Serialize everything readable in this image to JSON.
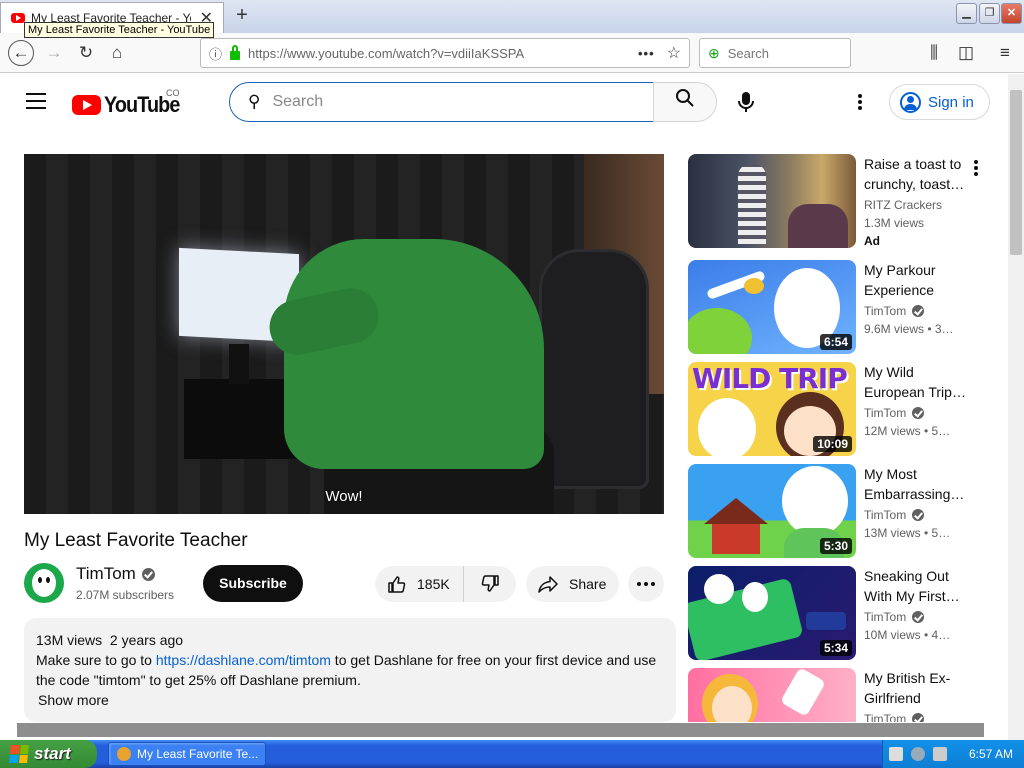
{
  "browser": {
    "tab_title": "My Least Favorite Teacher - YouTube",
    "tooltip": "My Least Favorite Teacher - YouTube",
    "url": "https://www.youtube.com/watch?v=vdiiIaKSSPA",
    "search_placeholder": "Search"
  },
  "header": {
    "logo_text": "YouTube",
    "region": "CO",
    "search_placeholder": "Search",
    "signin_label": "Sign in"
  },
  "video": {
    "caption": "Wow!",
    "title": "My Least Favorite Teacher",
    "channel": "TimTom",
    "subscribers": "2.07M subscribers",
    "subscribe_label": "Subscribe",
    "likes": "185K",
    "share_label": "Share"
  },
  "description": {
    "views": "13M views",
    "age": "2 years ago",
    "text_before": "Make sure to go to ",
    "link": "https://dashlane.com/timtom",
    "text_after": " to get Dashlane for free on your first device and use the code \"timtom\" to get 25% off Dashlane premium.",
    "show_more": "Show more"
  },
  "recommendations": [
    {
      "title": "Raise a toast to crunchy, toast…",
      "channel": "RITZ Crackers",
      "meta": "1.3M views",
      "ad": "Ad",
      "duration": "",
      "verified": false
    },
    {
      "title": "My Parkour Experience",
      "channel": "TimTom",
      "meta": "9.6M views  • 3…",
      "duration": "6:54",
      "verified": true
    },
    {
      "title": "My Wild European Trip…",
      "channel": "TimTom",
      "meta": "12M views  • 5…",
      "duration": "10:09",
      "verified": true,
      "thumb_text": "WILD TRIP"
    },
    {
      "title": "My Most Embarrassing…",
      "channel": "TimTom",
      "meta": "13M views  • 5…",
      "duration": "5:30",
      "verified": true
    },
    {
      "title": "Sneaking Out With My First…",
      "channel": "TimTom",
      "meta": "10M views  • 4…",
      "duration": "5:34",
      "verified": true
    },
    {
      "title": "My British Ex-Girlfriend",
      "channel": "TimTom",
      "meta": "",
      "duration": "",
      "verified": true
    }
  ],
  "taskbar": {
    "start_label": "start",
    "task_item": "My Least Favorite Te...",
    "clock": "6:57 AM"
  },
  "colors": {
    "yt_red": "#ff0000",
    "link_blue": "#065fd4",
    "xp_taskbar": "#245edb",
    "xp_start": "#3c9a3c"
  }
}
